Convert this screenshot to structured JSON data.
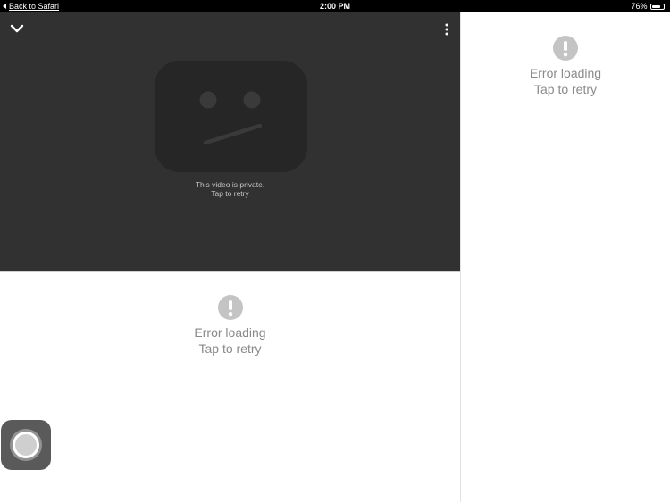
{
  "status_bar": {
    "back_label": "Back to Safari",
    "time": "2:00 PM",
    "battery_percent": "76%",
    "battery_level": 0.76
  },
  "player": {
    "message_line1": "This video is private.",
    "message_line2": "Tap to retry",
    "background_color": "#313131",
    "icons": {
      "collapse": "chevron-down-icon",
      "menu": "more-vertical-icon",
      "placeholder": "sad-face-icon"
    }
  },
  "right_panel": {
    "error_title": "Error loading",
    "error_action": "Tap to retry",
    "icon": "exclamation-circle-icon"
  },
  "bottom_panel": {
    "error_title": "Error loading",
    "error_action": "Tap to retry",
    "icon": "exclamation-circle-icon"
  },
  "assistive_touch": {
    "icon": "assistive-touch-icon"
  },
  "colors": {
    "error_icon": "#c4c4c4",
    "error_text": "#8a8a8a",
    "status_bar": "#000000"
  }
}
